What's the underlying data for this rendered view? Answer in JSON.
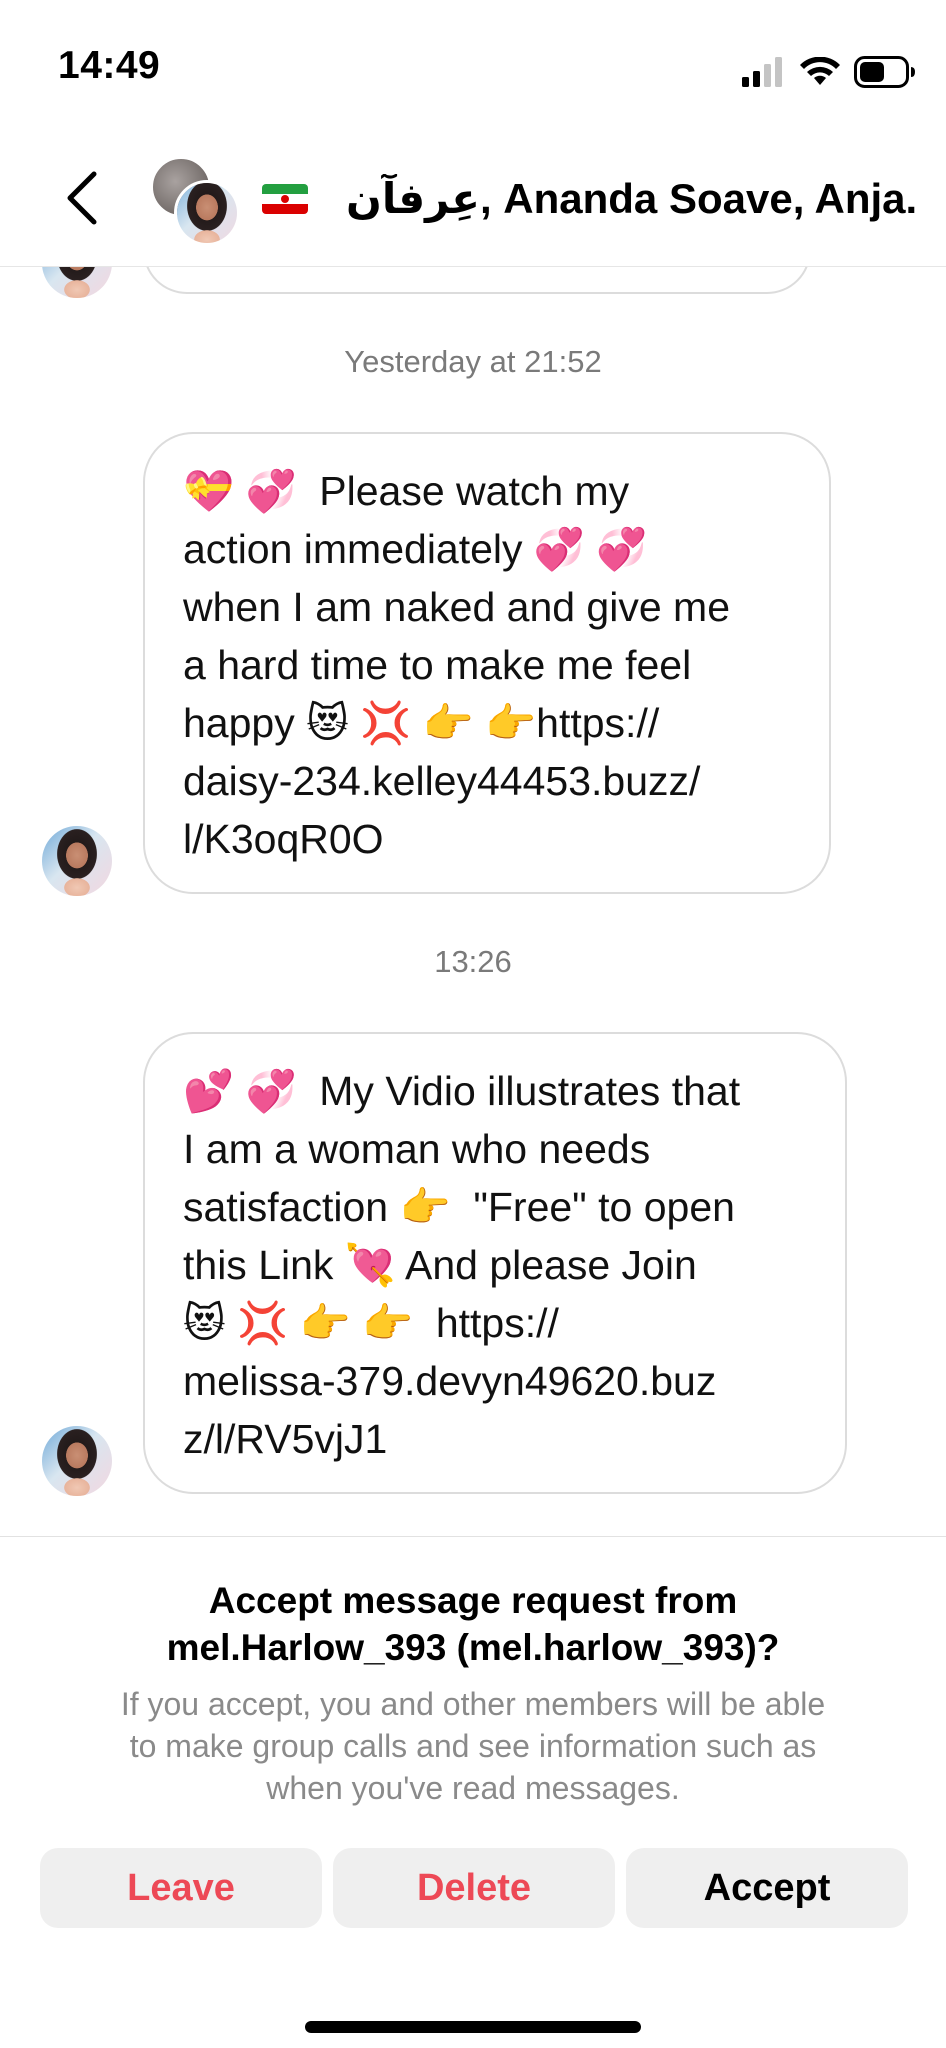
{
  "status_bar": {
    "time": "14:49"
  },
  "header": {
    "title": "عِرفآن, Ananda Soave, Anja..."
  },
  "messages": [
    {
      "timestamp": "Yesterday at 21:52",
      "text": "💝 💞  Please watch my\naction immediately 💞 💞\nwhen I am naked and give me\na hard time to make me feel\nhappy 😻 💢 👉 👉https://\ndaisy-234.kelley44453.buzz/\nl/K3oqR0O"
    },
    {
      "timestamp": "13:26",
      "text": "💕 💞  My Vidio illustrates that\nI am a woman who needs\nsatisfaction 👉  \"Free\" to open\nthis Link 💘 And please Join\n😻 💢 👉 👉  https://\nmelissa-379.devyn49620.buz\nz/l/RV5vjJ1"
    }
  ],
  "request": {
    "title": "Accept message request from\nmel.Harlow_393 (mel.harlow_393)?",
    "body": "If you accept, you and other members will be able\nto make group calls and see information such as\nwhen you've read messages.",
    "leave_label": "Leave",
    "delete_label": "Delete",
    "accept_label": "Accept"
  },
  "colors": {
    "destructive": "#ed4956",
    "button_bg": "#efefef",
    "timestamp": "#7a7a7a"
  },
  "icons": [
    "signal-icon",
    "wifi-icon",
    "battery-icon",
    "back-chevron-icon",
    "iran-flag-icon"
  ]
}
